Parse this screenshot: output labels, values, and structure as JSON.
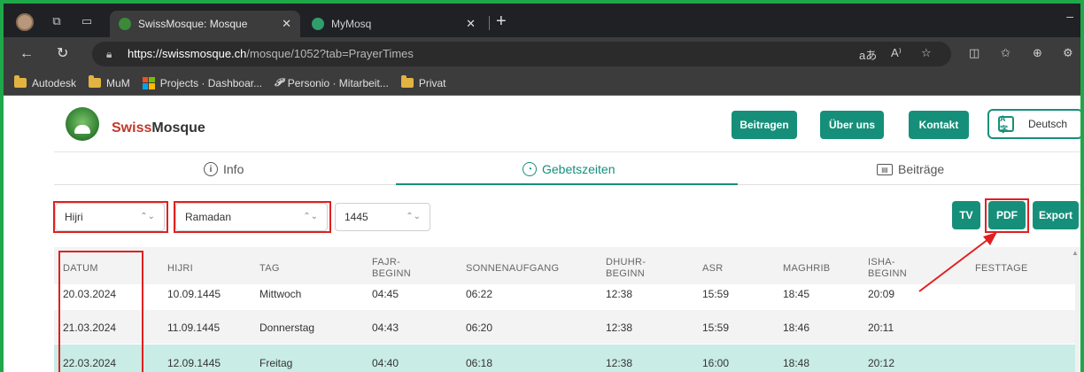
{
  "browser": {
    "tabs": [
      {
        "title": "SwissMosque: Mosque",
        "active": true
      },
      {
        "title": "MyMosq",
        "active": false
      }
    ],
    "url_host": "https://swissmosque.ch",
    "url_path": "/mosque/1052?tab=PrayerTimes",
    "bookmarks": [
      "Autodesk",
      "MuM",
      "Projects · Dashboar...",
      "Personio · Mitarbeit...",
      "Privat"
    ]
  },
  "site": {
    "brand_swiss": "Swiss",
    "brand_mosque": "Mosque",
    "buttons": {
      "contribute": "Beitragen",
      "about": "Über uns",
      "contact": "Kontakt"
    },
    "language": "Deutsch"
  },
  "nav_tabs": [
    {
      "label": "Info",
      "icon": "info-icon"
    },
    {
      "label": "Gebetszeiten",
      "icon": "clock-icon",
      "active": true
    },
    {
      "label": "Beiträge",
      "icon": "newspaper-icon"
    }
  ],
  "filters": {
    "calendar": "Hijri",
    "month": "Ramadan",
    "year": "1445"
  },
  "actions": {
    "tv": "TV",
    "pdf": "PDF",
    "export": "Export"
  },
  "table": {
    "headers": [
      {
        "line1": "DATUM",
        "line2": ""
      },
      {
        "line1": "HIJRI",
        "line2": ""
      },
      {
        "line1": "TAG",
        "line2": ""
      },
      {
        "line1": "FAJR-",
        "line2": "BEGINN"
      },
      {
        "line1": "SONNENAUFGANG",
        "line2": ""
      },
      {
        "line1": "DHUHR-",
        "line2": "BEGINN"
      },
      {
        "line1": "ASR",
        "line2": ""
      },
      {
        "line1": "MAGHRIB",
        "line2": ""
      },
      {
        "line1": "ISHA-",
        "line2": "BEGINN"
      },
      {
        "line1": "FESTTAGE",
        "line2": ""
      }
    ],
    "rows": [
      [
        "20.03.2024",
        "10.09.1445",
        "Mittwoch",
        "04:45",
        "06:22",
        "12:38",
        "15:59",
        "18:45",
        "20:09",
        ""
      ],
      [
        "21.03.2024",
        "11.09.1445",
        "Donnerstag",
        "04:43",
        "06:20",
        "12:38",
        "15:59",
        "18:46",
        "20:11",
        ""
      ],
      [
        "22.03.2024",
        "12.09.1445",
        "Freitag",
        "04:40",
        "06:18",
        "12:38",
        "16:00",
        "18:48",
        "20:12",
        ""
      ]
    ]
  },
  "colors": {
    "accent": "#168f7a",
    "highlight_row": "#c9ece6",
    "annotation": "#e02020",
    "window_border": "#1fa84a"
  }
}
